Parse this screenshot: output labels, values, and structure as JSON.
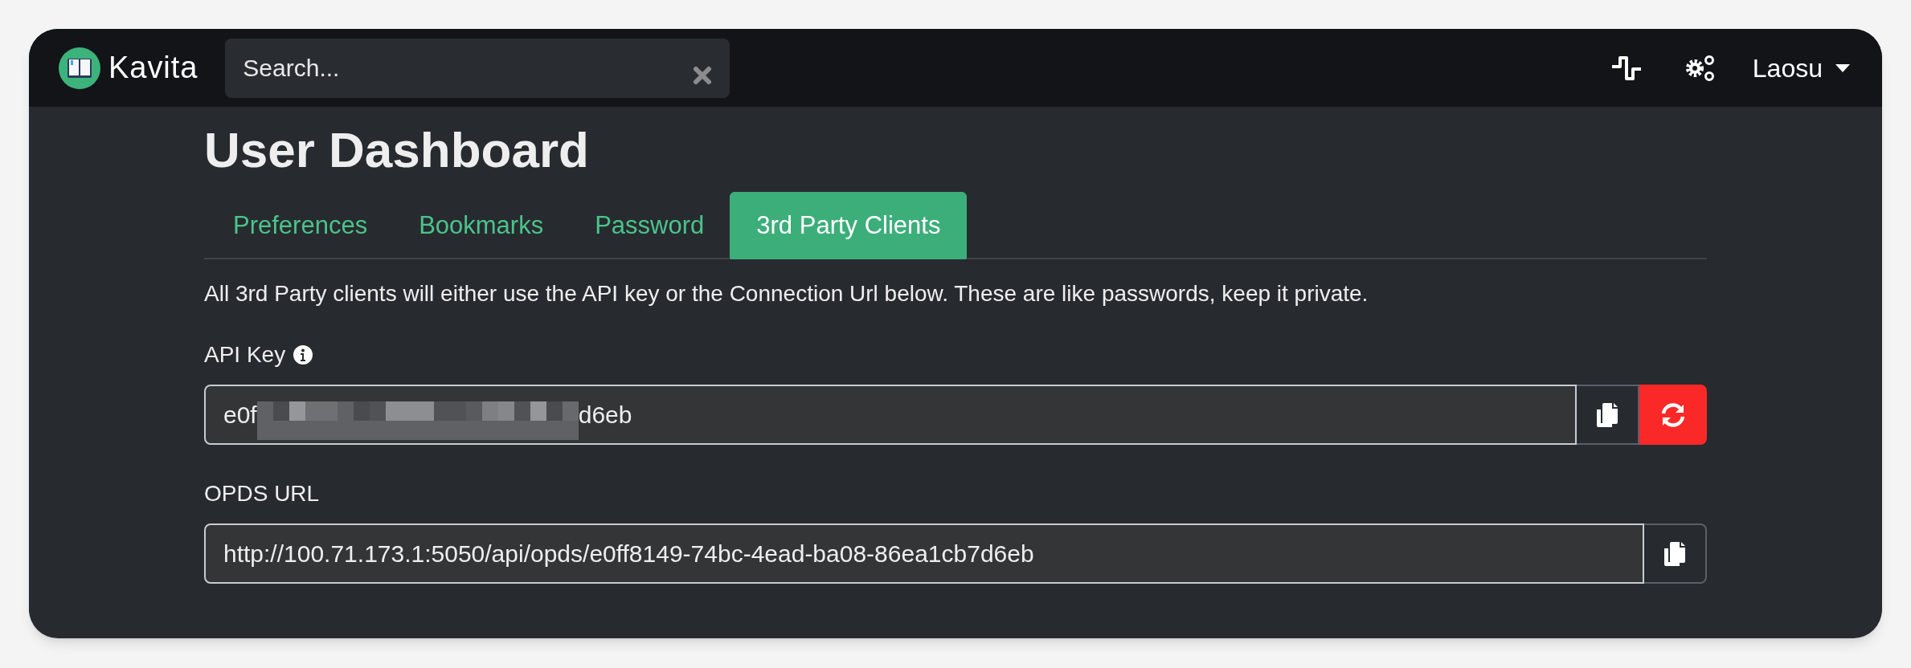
{
  "navbar": {
    "brand": "Kavita",
    "search": {
      "placeholder": "Search..."
    },
    "user": "Laosu"
  },
  "title": "User Dashboard",
  "tabs": [
    {
      "label": "Preferences",
      "selected": false
    },
    {
      "label": "Bookmarks",
      "selected": false
    },
    {
      "label": "Password",
      "selected": false
    },
    {
      "label": "3rd Party Clients",
      "selected": true
    }
  ],
  "description": "All 3rd Party clients will either use the API key or the Connection Url below. These are like passwords, keep it private.",
  "api_key": {
    "label": "API Key",
    "value_start": "e0f",
    "value_end": "d6eb"
  },
  "opds_url": {
    "label": "OPDS URL",
    "value": "http://100.71.173.1:5050/api/opds/e0ff8149-74bc-4ead-ba08-86ea1cb7d6eb"
  }
}
